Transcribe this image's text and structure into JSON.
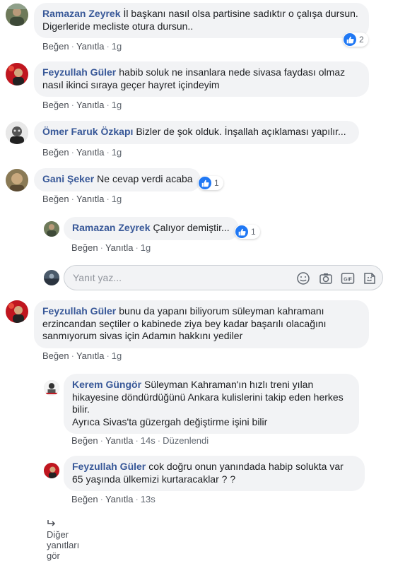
{
  "actions": {
    "like": "Beğen",
    "reply": "Yanıtla",
    "edited": "Düzenlendi",
    "sep": "·"
  },
  "comments": [
    {
      "author": "Ramazan Zeyrek",
      "text": "İl başkanı nasıl olsa partisine sadıktır o çalışa dursun. Digerleride mecliste otura dursun..",
      "time": "1g",
      "reactions": "2"
    },
    {
      "author": "Feyzullah Güler",
      "text": "habib soluk ne insanlara nede sivasa faydası olmaz nasıl ikinci sıraya geçer hayret içindeyim",
      "time": "1g"
    },
    {
      "author": "Ömer Faruk Özkapı",
      "text": "Bizler de şok olduk. İnşallah açıklaması yapılır...",
      "time": "1g"
    },
    {
      "author": "Gani Şeker",
      "text": "Ne cevap verdi acaba",
      "time": "1g",
      "reactions": "1",
      "replies": [
        {
          "author": "Ramazan Zeyrek",
          "text": "Çalıyor demiştir...",
          "time": "1g",
          "reactions": "1"
        }
      ]
    },
    {
      "author": "Feyzullah Güler",
      "text": "bunu da yapanı biliyorum süleyman kahramanı erzincandan seçtiler o kabinede ziya bey kadar başarılı olacağını sanmıyorum sivas için Adamın hakkını yediler",
      "time": "1g",
      "replies": [
        {
          "author": "Kerem Güngör",
          "text": "Süleyman Kahraman'ın hızlı treni yılan hikayesine döndürdüğünü Ankara kulislerini takip eden herkes bilir.",
          "text2": "Ayrıca Sivas'ta güzergah değiştirme işini bilir",
          "time": "14s"
        },
        {
          "author": "Feyzullah Güler",
          "text": "cok doğru onun yanındada habip solukta var 65 yaşında ülkemizi kurtaracaklar ? ?",
          "time": "13s"
        }
      ]
    }
  ],
  "reply_box": {
    "placeholder": "Yanıt yaz..."
  },
  "more_replies": "Diğer yanıtları gör",
  "icons": {
    "reply_emoji": "smiley-icon",
    "reply_camera": "camera-icon",
    "reply_gif": "gif-icon",
    "reply_sticker": "sticker-icon",
    "like_reaction": "thumbs-up-icon",
    "reply_arrow": "reply-arrow-icon"
  },
  "colors": {
    "author": "#385898",
    "like": "#2078f4",
    "bubble": "#f2f3f5"
  }
}
